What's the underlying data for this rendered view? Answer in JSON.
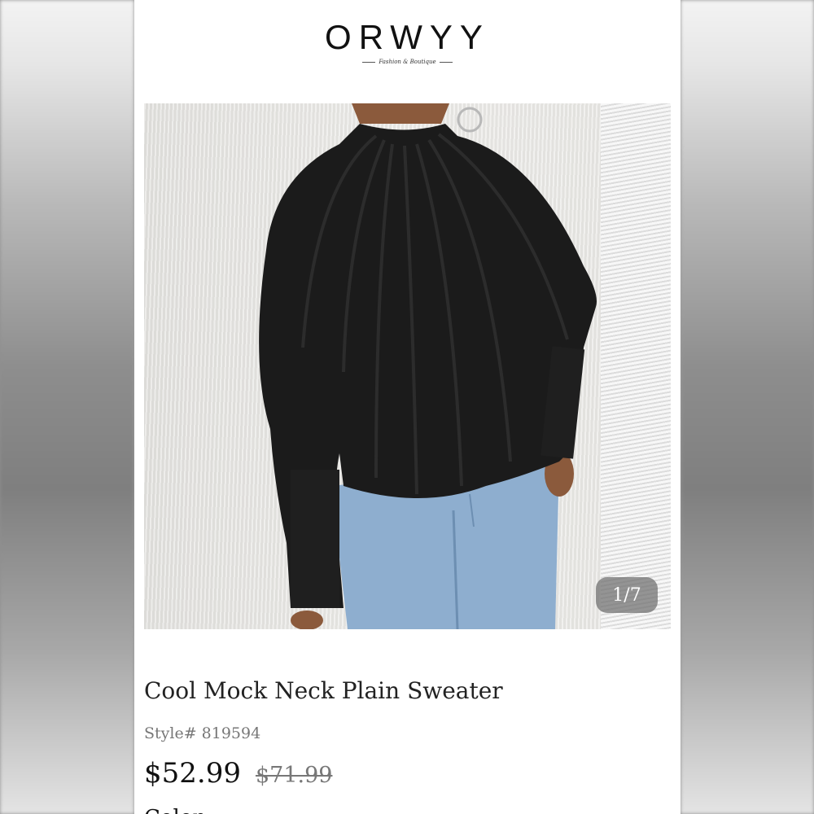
{
  "brand": {
    "logo": "ORWYY",
    "tagline": "Fashion & Boutique"
  },
  "gallery": {
    "image_alt": "Black mock neck sweater with raglan seam details worn with light blue jeans",
    "counter": "1/7"
  },
  "product": {
    "title": "Cool Mock Neck Plain Sweater",
    "style": "Style# 819594",
    "price": "$52.99",
    "original_price": "$71.99",
    "next_section_label": "Color"
  },
  "colors": {
    "sweater": "#1b1b1b",
    "jeans": "#8eaecf",
    "badge": "#6e6e6e"
  }
}
